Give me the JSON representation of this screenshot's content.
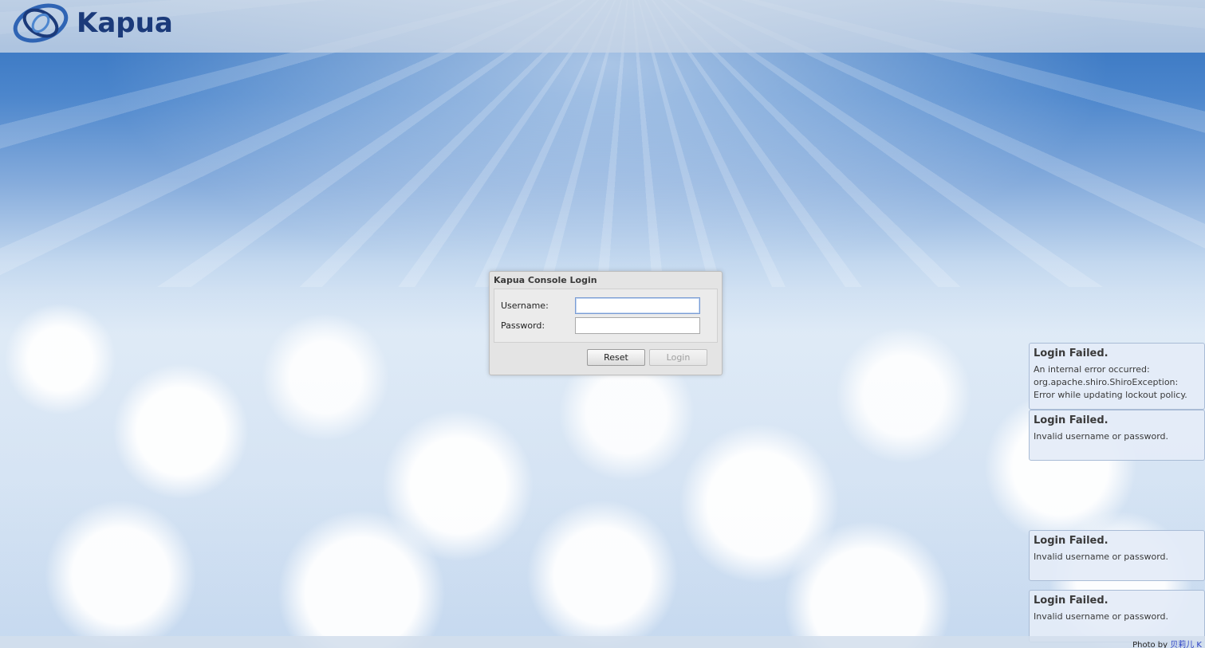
{
  "brand": {
    "name": "Kapua",
    "logo_icon": "kapua-swirl-logo"
  },
  "login": {
    "title": "Kapua Console Login",
    "username_label": "Username:",
    "password_label": "Password:",
    "username_value": "",
    "password_value": "",
    "reset_label": "Reset",
    "login_label": "Login",
    "login_enabled": false
  },
  "notifications": [
    {
      "title": "Login Failed.",
      "message": "An internal error occurred: org.apache.shiro.ShiroException: Error while updating lockout policy."
    },
    {
      "title": "Login Failed.",
      "message": "Invalid username or password."
    },
    {
      "title": "Login Failed.",
      "message": "Invalid username or password."
    },
    {
      "title": "Login Failed.",
      "message": "Invalid username or password."
    }
  ],
  "footer": {
    "credit_prefix": "Photo by",
    "credit_link": "贝莉儿 K"
  },
  "colors": {
    "brand_text": "#1b3a7a",
    "focus_border": "#7a9cd3",
    "link": "#2a3fc4"
  }
}
